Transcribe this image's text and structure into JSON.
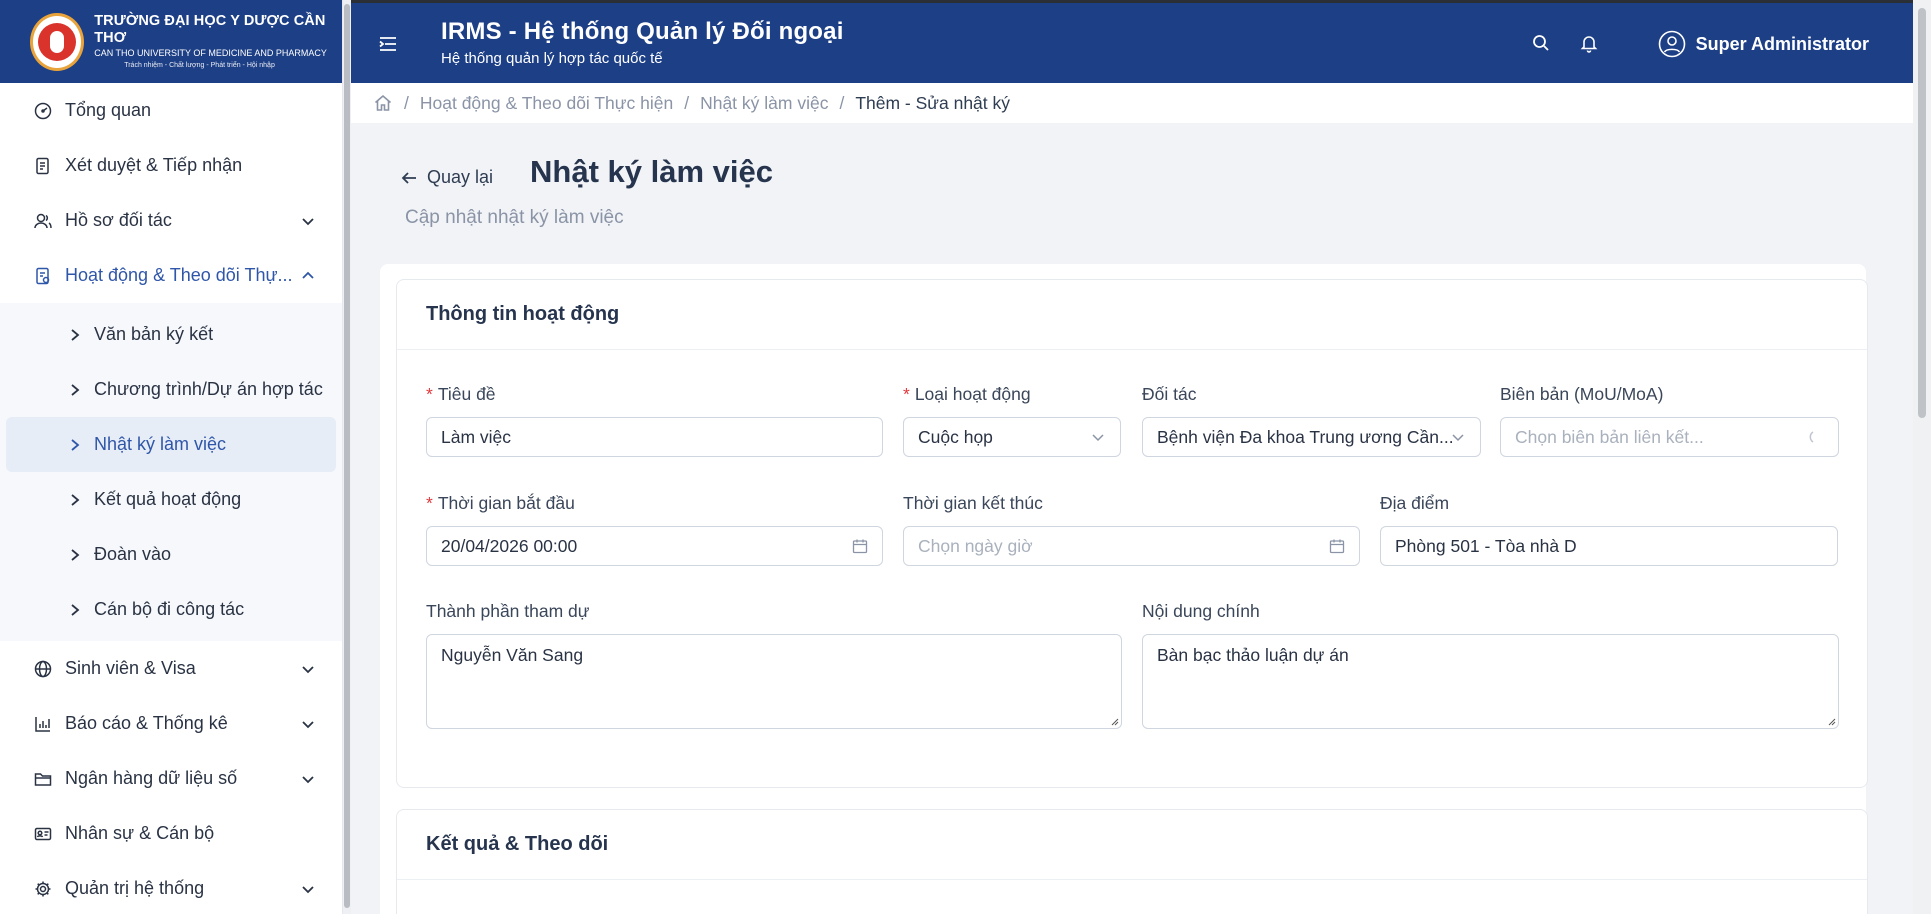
{
  "brand": {
    "name": "TRƯỜNG ĐẠI HỌC Y DƯỢC CẦN THƠ",
    "english": "CAN THO UNIVERSITY OF MEDICINE AND PHARMACY",
    "slogan": "Trách nhiệm - Chất lượng - Phát triển - Hội nhập"
  },
  "sidebar": {
    "items": [
      {
        "label": "Tổng quan",
        "icon": "dashboard-icon"
      },
      {
        "label": "Xét duyệt & Tiếp nhận",
        "icon": "approval-icon"
      },
      {
        "label": "Hồ sơ đối tác",
        "icon": "partners-icon",
        "expandable": true
      },
      {
        "label": "Hoạt động & Theo dõi Thự...",
        "icon": "activity-icon",
        "expanded": true
      },
      {
        "label": "Sinh viên & Visa",
        "icon": "globe-icon",
        "expandable": true
      },
      {
        "label": "Báo cáo & Thống kê",
        "icon": "chart-icon",
        "expandable": true
      },
      {
        "label": "Ngân hàng dữ liệu số",
        "icon": "folder-icon",
        "expandable": true
      },
      {
        "label": "Nhân sự & Cán bộ",
        "icon": "id-card-icon"
      },
      {
        "label": "Quản trị hệ thống",
        "icon": "gear-icon",
        "expandable": true
      }
    ],
    "submenu": [
      "Văn bản ký kết",
      "Chương trình/Dự án hợp tác",
      "Nhật ký làm việc",
      "Kết quả hoạt động",
      "Đoàn vào",
      "Cán bộ đi công tác"
    ]
  },
  "header": {
    "title": "IRMS - Hệ thống Quản lý Đối ngoại",
    "subtitle": "Hệ thống quản lý hợp tác quốc tế",
    "user": "Super Administrator"
  },
  "breadcrumb": [
    "Hoạt động & Theo dõi Thực hiện",
    "Nhật ký làm việc",
    "Thêm - Sửa nhật ký"
  ],
  "page": {
    "back_label": "Quay lại",
    "title": "Nhật ký làm việc",
    "subtitle": "Cập nhật nhật ký làm việc"
  },
  "form": {
    "section1_title": "Thông tin hoạt động",
    "section2_title": "Kết quả & Theo dõi",
    "title_label": "Tiêu đề",
    "title_value": "Làm việc",
    "type_label": "Loại hoạt động",
    "type_value": "Cuộc họp",
    "partner_label": "Đối tác",
    "partner_value": "Bệnh viện Đa khoa Trung ương Cần...",
    "minutes_label": "Biên bản (MoU/MoA)",
    "minutes_placeholder": "Chọn biên bản liên kết...",
    "start_label": "Thời gian bắt đầu",
    "start_value": "20/04/2026 00:00",
    "end_label": "Thời gian kết thúc",
    "end_placeholder": "Chọn ngày giờ",
    "location_label": "Địa điểm",
    "location_value": "Phòng 501 - Tòa nhà D",
    "participants_label": "Thành phần tham dự",
    "participants_value": "Nguyễn Văn Sang",
    "content_label": "Nội dung chính",
    "content_value": "Bàn bạc thảo luận dự án"
  }
}
